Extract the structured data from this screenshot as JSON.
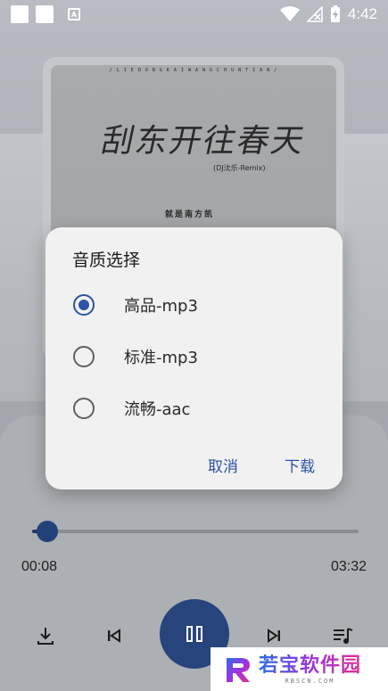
{
  "status_bar": {
    "time": "4:42",
    "icons": [
      "notification-square-icon",
      "notification-square-icon",
      "accessibility-a-icon",
      "wifi-icon",
      "no-signal-icon",
      "battery-charging-icon"
    ]
  },
  "album": {
    "header_strip": "/ L I E D O N G K A I W A N G C H U N T I A N /",
    "title_calligraphy": "刮东开往春天",
    "subtitle": "(DJ沈乐-Remix)",
    "artist": "就是南方凯"
  },
  "player": {
    "time_current": "00:08",
    "time_total": "03:32",
    "progress_fraction": 0.04,
    "controls": [
      "download-icon",
      "previous-icon",
      "pause-icon",
      "next-icon",
      "playlist-icon"
    ]
  },
  "dialog": {
    "title": "音质选择",
    "options": [
      {
        "label": "高品-mp3",
        "selected": true
      },
      {
        "label": "标准-mp3",
        "selected": false
      },
      {
        "label": "流畅-aac",
        "selected": false
      }
    ],
    "cancel_label": "取消",
    "download_label": "下载"
  },
  "watermark": {
    "main": "若宝软件园",
    "sub": "RBSCN.COM"
  },
  "colors": {
    "accent": "#2d53a6",
    "play_button": "#27447c",
    "dialog_bg": "#f1f1f1"
  }
}
